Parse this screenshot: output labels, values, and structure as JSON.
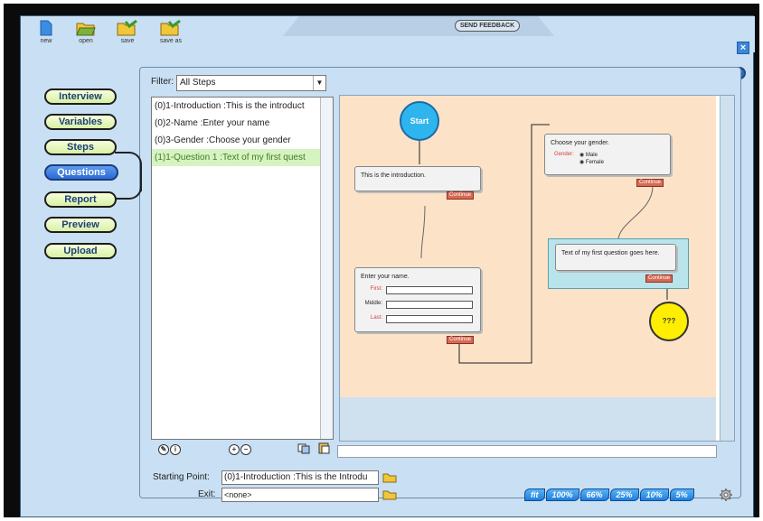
{
  "toolbar": {
    "new_label": "new",
    "open_label": "open",
    "save_label": "save",
    "save_as_label": "save as"
  },
  "feedback": {
    "label": "SEND FEEDBACK"
  },
  "close": {
    "label": "×"
  },
  "help": {
    "label": "?"
  },
  "nav": {
    "interview": "Interview",
    "variables": "Variables",
    "steps": "Steps",
    "questions": "Questions",
    "report": "Report",
    "preview": "Preview",
    "upload": "Upload"
  },
  "filter": {
    "label": "Filter:",
    "value": "All Steps"
  },
  "steps": [
    "(0)1-Introduction :This is the introduct",
    "(0)2-Name :Enter your name",
    "(0)3-Gender :Choose your gender",
    "(1)1-Question 1 :Text of my first quest"
  ],
  "flow": {
    "start": "Start",
    "end": "???",
    "intro_text": "This is the introduction.",
    "name_text": "Enter your name.",
    "first_label": "First:",
    "middle_label": "Middle:",
    "last_label": "Last:",
    "gender_text": "Choose your gender.",
    "gender_label": "Gender:",
    "male": "Male",
    "female": "Female",
    "question_text": "Text of my first question goes here.",
    "continue": "Continue"
  },
  "starting_point": {
    "label": "Starting Point:",
    "value": "(0)1-Introduction :This is the Introdu"
  },
  "exit": {
    "label": "Exit:",
    "value": "<none>"
  },
  "zoom": [
    "fit",
    "100%",
    "66%",
    "25%",
    "10%",
    "5%"
  ],
  "colors": {
    "accent": "#2a6ad6",
    "nav_button": "#d8f0a4",
    "canvas": "#fce3c8",
    "selected_step": "#d6f3c2"
  }
}
